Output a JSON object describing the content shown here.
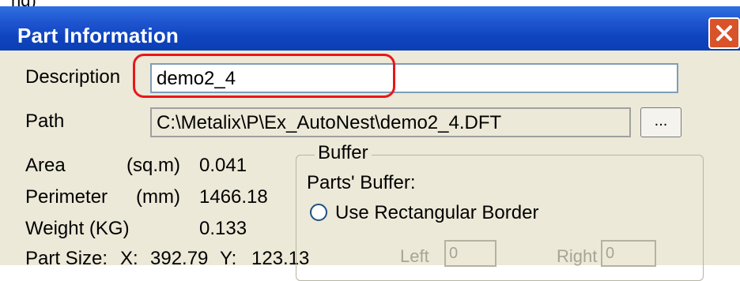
{
  "window": {
    "outer_fragment": "ng)",
    "title": "Part Information"
  },
  "form": {
    "description_label": "Description",
    "description_value": "demo2_4",
    "path_label": "Path",
    "path_value": "C:\\Metalix\\P\\Ex_AutoNest\\demo2_4.DFT",
    "browse_label": "..."
  },
  "stats": {
    "area_label": "Area",
    "area_unit": "(sq.m)",
    "area_value": "0.041",
    "perimeter_label": "Perimeter",
    "perimeter_unit": "(mm)",
    "perimeter_value": "1466.18",
    "weight_label": "Weight (KG)",
    "weight_value": "0.133",
    "partsize_label": "Part Size:",
    "x_label": "X:",
    "x_value": "392.79",
    "y_label": "Y:",
    "y_value": "123.13"
  },
  "buffer": {
    "group_title": "Buffer",
    "parts_buffer_label": "Parts' Buffer:",
    "radio_label": "Use Rectangular Border",
    "left_label": "Left",
    "left_value": "0",
    "right_label": "Right",
    "right_value": "0"
  },
  "colors": {
    "titlebar": "#0b3fb4",
    "dialog_bg": "#ece9d8",
    "highlight": "#e8171a",
    "close_button": "#d8532a"
  },
  "icons": {
    "close": "close-icon"
  }
}
